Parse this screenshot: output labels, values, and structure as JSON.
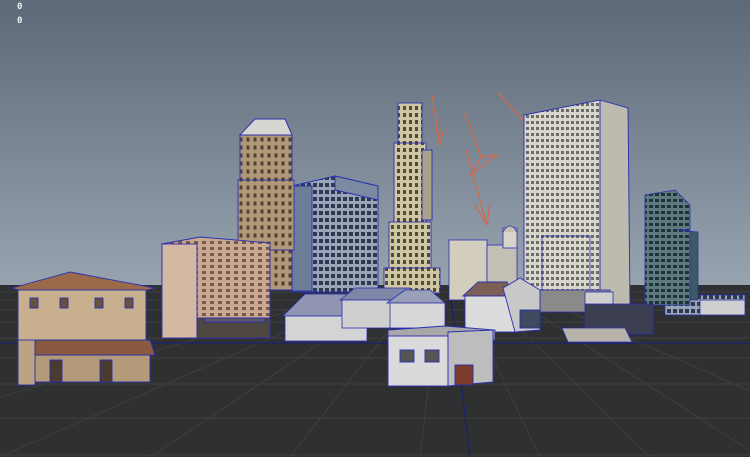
{
  "viewport": {
    "hud_readouts": [
      "0",
      "0"
    ]
  },
  "colors": {
    "sky_top": "#5d6978",
    "sky_bottom": "#9aa6b2",
    "ground": "#2f3031",
    "grid_line": "#3c3e40",
    "grid_axis": "#1a1f66",
    "wireframe": "#2a2fb0",
    "annotation": "#d06a4c"
  }
}
